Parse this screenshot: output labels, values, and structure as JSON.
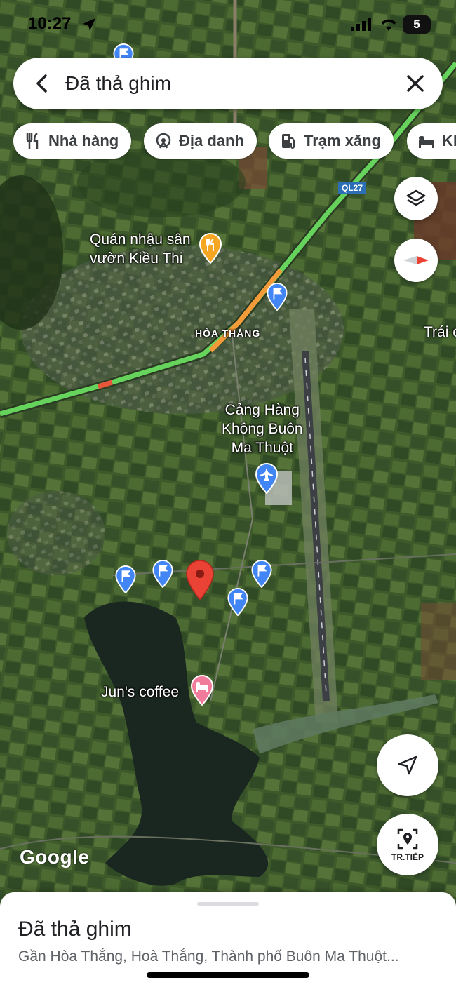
{
  "status_bar": {
    "time": "10:27",
    "battery": "5"
  },
  "search": {
    "title": "Đã thả ghim"
  },
  "chips": [
    {
      "label": "Nhà hàng",
      "icon": "restaurant-icon"
    },
    {
      "label": "Địa danh",
      "icon": "landmark-icon"
    },
    {
      "label": "Trạm xăng",
      "icon": "gas-station-icon"
    },
    {
      "label": "Kh",
      "icon": "hotel-icon"
    }
  ],
  "map": {
    "road_shield": "QL27",
    "labels": {
      "restaurant_poi": "Quán nhậu sân\nvườn Kiều Thi",
      "district": "HÒA THẮNG",
      "airport": "Cảng Hàng\nKhông Buôn\nMa Thuột",
      "cafe": "Jun's coffee",
      "edge": "Trái c"
    },
    "colors": {
      "pin_red": "#ea4335",
      "pin_blue": "#4285f4",
      "traffic_green": "#66d35c",
      "traffic_orange": "#f29b38",
      "poi_orange": "#f5a623",
      "poi_pink": "#f07b9b"
    }
  },
  "buttons": {
    "next_label": "TR.TIẾP"
  },
  "google_logo": "Google",
  "sheet": {
    "title": "Đã thả ghim",
    "subtitle": "Gần Hòa Thắng, Hoà Thắng, Thành phố Buôn Ma Thuột..."
  }
}
